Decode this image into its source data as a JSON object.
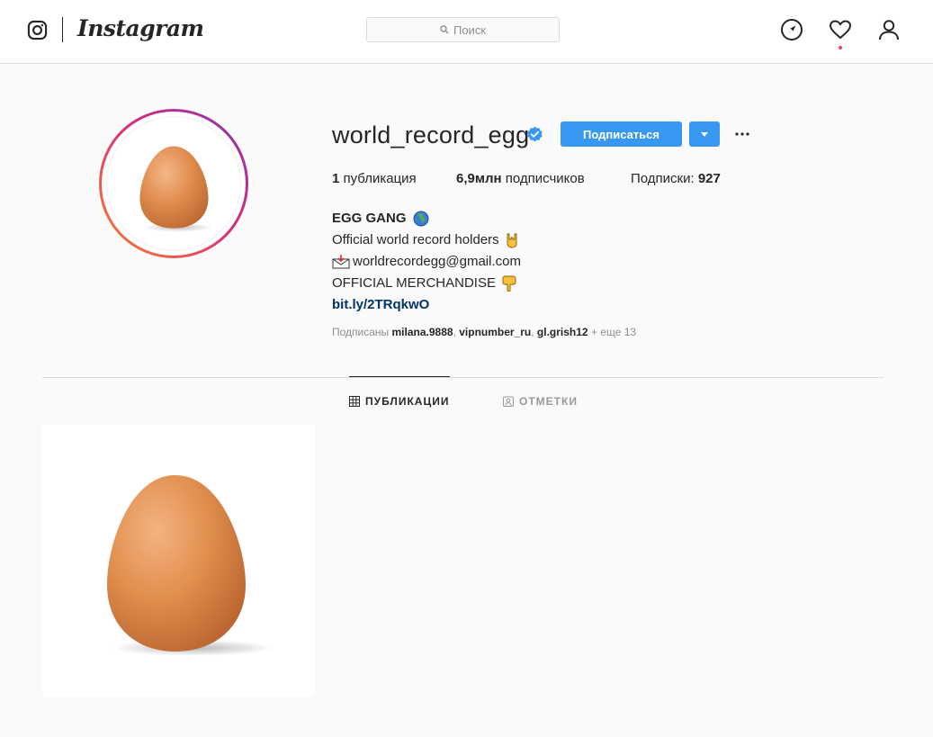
{
  "header": {
    "wordmark": "Instagram",
    "search_placeholder": "Поиск"
  },
  "profile": {
    "username": "world_record_egg",
    "follow_label": "Подписаться",
    "stats": {
      "posts_count": "1",
      "posts_label": "публикация",
      "followers_count": "6,9млн",
      "followers_label": "подписчиков",
      "following_label": "Подписки:",
      "following_count": "927"
    },
    "bio": {
      "name": "EGG GANG",
      "line1": "Official world record holders",
      "email": "worldrecordegg@gmail.com",
      "line3": "OFFICIAL MERCHANDISE",
      "link": "bit.ly/2TRqkwO"
    },
    "followed_by": {
      "prefix": "Подписаны",
      "user1": "milana.9888",
      "user2": "vipnumber_ru",
      "user3": "gl.grish12",
      "more": "+ еще 13"
    }
  },
  "tabs": {
    "posts": "ПУБЛИКАЦИИ",
    "tagged": "ОТМЕТКИ"
  },
  "colors": {
    "accent": "#3897f0",
    "link": "#003569",
    "notification": "#ed4956"
  }
}
